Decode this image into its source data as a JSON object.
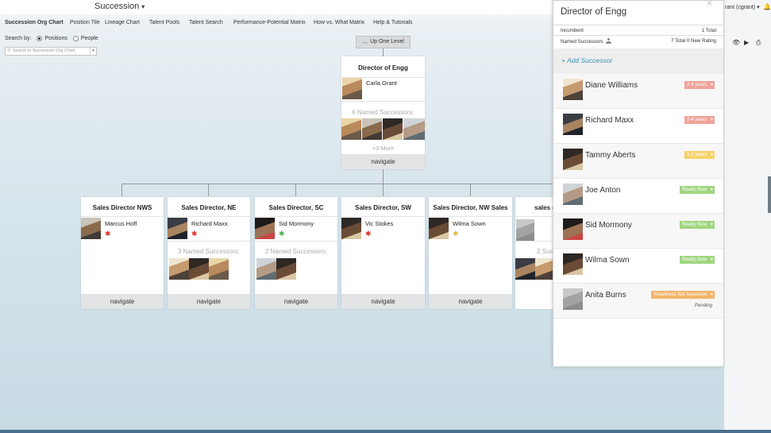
{
  "app": {
    "title": "Succession",
    "caret": "▾"
  },
  "user": {
    "label": "rant (cgrant)",
    "caret": "▾"
  },
  "nav": {
    "items": [
      {
        "label": "Succession Org Chart",
        "active": true
      },
      {
        "label": "Position Tile"
      },
      {
        "label": "Lineage Chart"
      },
      {
        "label": "Talent Pools"
      },
      {
        "label": "Talent Search"
      },
      {
        "label": "Performance-Potential Matrix"
      },
      {
        "label": "How vs. What Matrix"
      },
      {
        "label": "Help & Tutorials"
      }
    ]
  },
  "search": {
    "by_label": "Search by:",
    "option_positions": "Positions",
    "option_people": "People",
    "placeholder": "Search in Succession Org Chart"
  },
  "up_level": "Up One Level",
  "root": {
    "title": "Director of Engg",
    "incumbent": "Carla Grant",
    "successors_label": "6 Named Successors:",
    "more": "+3 More",
    "navigate": "navigate"
  },
  "children": [
    {
      "title": "Sales Director NWS",
      "incumbent": "Marcus Hoff",
      "successors_label": "",
      "navigate": "navigate"
    },
    {
      "title": "Sales Director, NE",
      "incumbent": "Richard Maxx",
      "successors_label": "3 Named Successors:",
      "navigate": "navigate"
    },
    {
      "title": "Sales Director, SC",
      "incumbent": "Sid Mormony",
      "successors_label": "2 Named Successors:",
      "navigate": "navigate"
    },
    {
      "title": "Sales Director, SW",
      "incumbent": "Vic Stokes",
      "successors_label": "",
      "navigate": "navigate"
    },
    {
      "title": "Sales Director, NW Sales",
      "incumbent": "Wilma Sown",
      "successors_label": "",
      "navigate": "navigate"
    },
    {
      "title": "sales d",
      "incumbent": "",
      "successors_label": "2 Suc",
      "navigate": ""
    }
  ],
  "panel": {
    "title": "Director of Engg",
    "incumbent_label": "Incumbent",
    "incumbent_total": "1 Total",
    "named_label": "Named Successors",
    "named_total": "7 Total 0 New Rating",
    "add_label": "+ Add Successor",
    "successors": [
      {
        "name": "Diane Williams",
        "readiness": "2-4 years",
        "color": "#f0a29a"
      },
      {
        "name": "Richard Maxx",
        "readiness": "2-4 years",
        "color": "#f0a29a"
      },
      {
        "name": "Tammy Aberts",
        "readiness": "1-2 years",
        "color": "#f6d26b"
      },
      {
        "name": "Joe Anton",
        "readiness": "Ready Now",
        "color": "#9fd67f"
      },
      {
        "name": "Sid Mormony",
        "readiness": "Ready Now",
        "color": "#9fd67f"
      },
      {
        "name": "Wilma Sown",
        "readiness": "Ready Now",
        "color": "#9fd67f"
      },
      {
        "name": "Anita Burns",
        "readiness": "Readiness Not Assessed",
        "color": "#f4b56a",
        "status": "Pending"
      }
    ]
  },
  "colors": {
    "accent": "#3a8fb7",
    "puzzle_red": "#d9342b",
    "puzzle_green": "#4bb34b",
    "puzzle_yellow": "#e2b93b"
  },
  "icons": {
    "close": "×",
    "eye": "eye-icon",
    "play": "play-icon",
    "print": "print-icon",
    "bell": "bell-icon"
  }
}
